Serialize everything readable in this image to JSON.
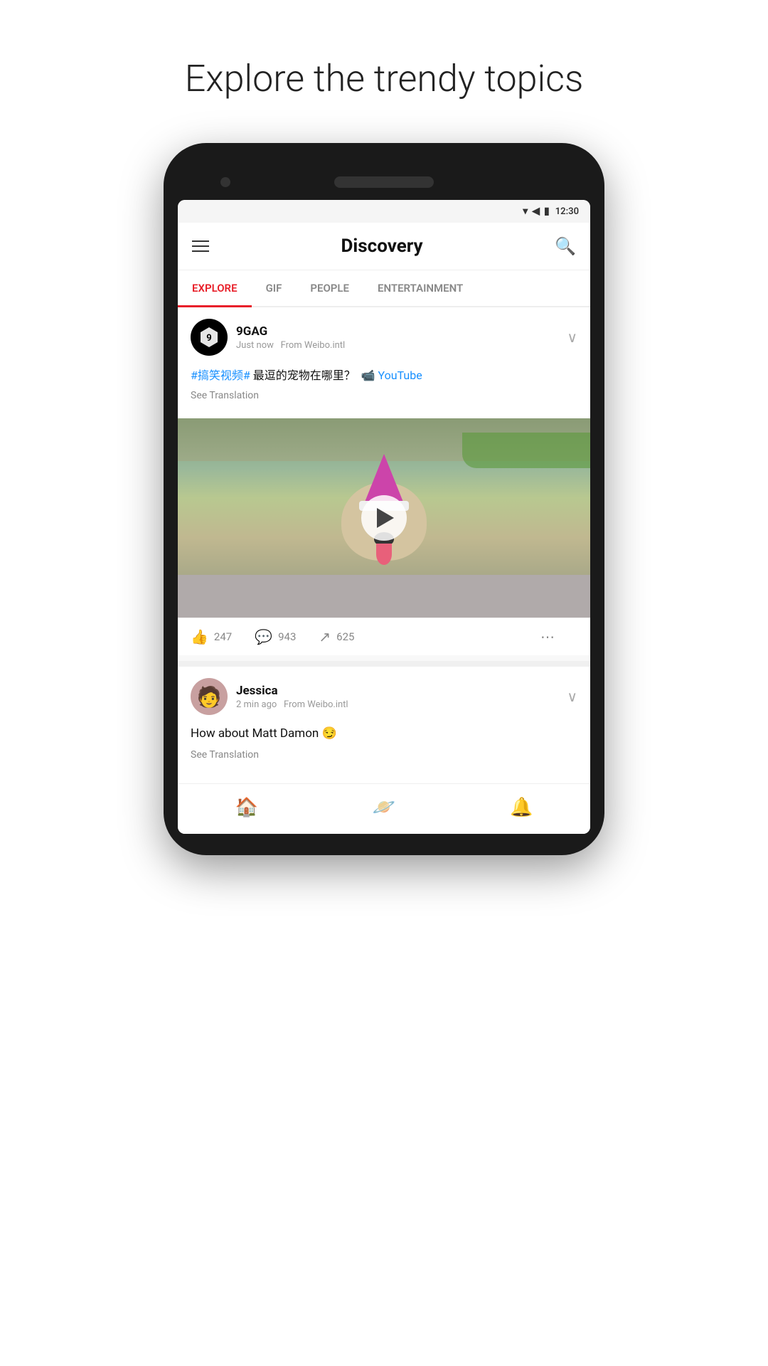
{
  "page": {
    "title": "Explore the trendy topics"
  },
  "status_bar": {
    "time": "12:30",
    "wifi": "▾",
    "signal": "▲",
    "battery": "▮"
  },
  "header": {
    "title": "Discovery",
    "menu_label": "Menu",
    "search_label": "Search"
  },
  "tabs": [
    {
      "id": "explore",
      "label": "EXPLORE",
      "active": true
    },
    {
      "id": "gif",
      "label": "GIF",
      "active": false
    },
    {
      "id": "people",
      "label": "PEOPLE",
      "active": false
    },
    {
      "id": "entertainment",
      "label": "ENTERTAINMENT",
      "active": false
    }
  ],
  "posts": [
    {
      "id": "post1",
      "username": "9GAG",
      "time": "Just now",
      "source": "From Weibo.intl",
      "hashtag": "#搞笑视频#",
      "text_cn": " 最逗的宠物在哪里？",
      "yt_label": "📹 YouTube",
      "see_translation": "See Translation",
      "has_video": true,
      "likes": "247",
      "comments": "943",
      "shares": "625"
    },
    {
      "id": "post2",
      "username": "Jessica",
      "time": "2 min ago",
      "source": "From Weibo.intl",
      "text": "How about Matt Damon 😏",
      "see_translation": "See Translation"
    }
  ],
  "bottom_nav": {
    "items": [
      {
        "id": "home",
        "label": "Home",
        "icon": "🏠",
        "active": false
      },
      {
        "id": "discover",
        "label": "Discover",
        "icon": "🪐",
        "active": false
      },
      {
        "id": "notifications",
        "label": "Notifications",
        "icon": "🔔",
        "active": false
      }
    ]
  }
}
